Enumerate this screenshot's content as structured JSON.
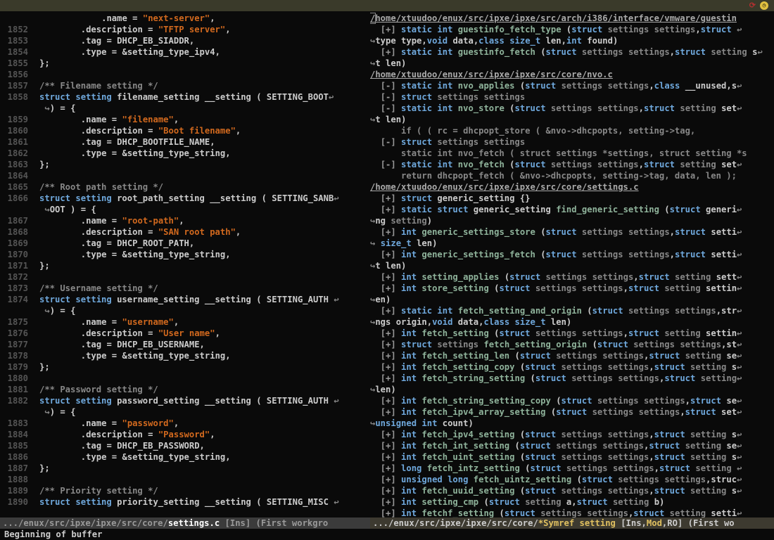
{
  "topbar": {
    "clock_glyph": "◷",
    "sync_glyph": "⟳"
  },
  "left": {
    "lines": [
      {
        "n": "",
        "raw": "            .name = \"next-server\","
      },
      {
        "n": "1852",
        "raw": "        .description = \"TFTP server\","
      },
      {
        "n": "1853",
        "raw": "        .tag = DHCP_EB_SIADDR,"
      },
      {
        "n": "1854",
        "raw": "        .type = &setting_type_ipv4,"
      },
      {
        "n": "1855",
        "raw": "};"
      },
      {
        "n": "1856",
        "raw": ""
      },
      {
        "n": "1857",
        "raw": "/** Filename setting */"
      },
      {
        "n": "1858",
        "raw": "struct setting filename_setting __setting ( SETTING_BOOT",
        "wrap": true
      },
      {
        "n": "",
        "wraplead": true,
        "raw": ") = {"
      },
      {
        "n": "1859",
        "raw": "        .name = \"filename\","
      },
      {
        "n": "1860",
        "raw": "        .description = \"Boot filename\","
      },
      {
        "n": "1861",
        "raw": "        .tag = DHCP_BOOTFILE_NAME,"
      },
      {
        "n": "1862",
        "raw": "        .type = &setting_type_string,"
      },
      {
        "n": "1863",
        "raw": "};"
      },
      {
        "n": "1864",
        "raw": ""
      },
      {
        "n": "1865",
        "raw": "/** Root path setting */"
      },
      {
        "n": "1866",
        "raw": "struct setting root_path_setting __setting ( SETTING_SANB",
        "wrap": true
      },
      {
        "n": "",
        "wraplead": true,
        "raw": "OOT ) = {"
      },
      {
        "n": "1867",
        "raw": "        .name = \"root-path\","
      },
      {
        "n": "1868",
        "raw": "        .description = \"SAN root path\","
      },
      {
        "n": "1869",
        "raw": "        .tag = DHCP_ROOT_PATH,"
      },
      {
        "n": "1870",
        "raw": "        .type = &setting_type_string,"
      },
      {
        "n": "1871",
        "raw": "};"
      },
      {
        "n": "1872",
        "raw": ""
      },
      {
        "n": "1873",
        "raw": "/** Username setting */"
      },
      {
        "n": "1874",
        "raw": "struct setting username_setting __setting ( SETTING_AUTH ",
        "wrap": true
      },
      {
        "n": "",
        "wraplead": true,
        "raw": ") = {"
      },
      {
        "n": "1875",
        "raw": "        .name = \"username\","
      },
      {
        "n": "1876",
        "raw": "        .description = \"User name\","
      },
      {
        "n": "1877",
        "raw": "        .tag = DHCP_EB_USERNAME,"
      },
      {
        "n": "1878",
        "raw": "        .type = &setting_type_string,"
      },
      {
        "n": "1879",
        "raw": "};"
      },
      {
        "n": "1880",
        "raw": ""
      },
      {
        "n": "1881",
        "raw": "/** Password setting */"
      },
      {
        "n": "1882",
        "raw": "struct setting password_setting __setting ( SETTING_AUTH ",
        "wrap": true
      },
      {
        "n": "",
        "wraplead": true,
        "raw": ") = {"
      },
      {
        "n": "1883",
        "raw": "        .name = \"password\","
      },
      {
        "n": "1884",
        "raw": "        .description = \"Password\","
      },
      {
        "n": "1885",
        "raw": "        .tag = DHCP_EB_PASSWORD,"
      },
      {
        "n": "1886",
        "raw": "        .type = &setting_type_string,"
      },
      {
        "n": "1887",
        "raw": "};"
      },
      {
        "n": "1888",
        "raw": ""
      },
      {
        "n": "1889",
        "raw": "/** Priority setting */"
      },
      {
        "n": "1890",
        "raw": "struct setting priority_setting __setting ( SETTING_MISC ",
        "wrap": true,
        "cursor": 8
      }
    ],
    "modeline_prefix": ".../enux/src/ipxe/ipxe/src/core/",
    "modeline_file": "settings.c",
    "modeline_suffix": "   [Ins] (First workgro"
  },
  "right": {
    "lines": [
      {
        "path": "/home/xtuudoo/enux/src/ipxe/ipxe/src/arch/i386/interface/vmware/guestin",
        "cursor": true
      },
      {
        "fold": "[+]",
        "sig": "static int guestinfo_fetch_type (struct settings settings,struct ",
        "wrap": true
      },
      {
        "cont": true,
        "sig2": "type type,void data,class size_t len,int found)"
      },
      {
        "fold": "[+]",
        "sig": "static int guestinfo_fetch (struct settings settings,struct setting s",
        "wrap": true
      },
      {
        "cont": true,
        "sig2": "t len)"
      },
      {
        "path": "/home/xtuudoo/enux/src/ipxe/ipxe/src/core/nvo.c"
      },
      {
        "fold": "[-]",
        "sig": "static int nvo_applies (struct settings settings,class __unused,s",
        "wrap": true
      },
      {
        "fold": "[-]",
        "sig": "struct settings settings"
      },
      {
        "fold": "[-]",
        "sig": "static int nvo_store (struct settings settings,struct setting set",
        "wrap": true
      },
      {
        "cont": true,
        "sig2": "t len)"
      },
      {
        "body": "      if ( ( rc = dhcpopt_store ( &nvo->dhcpopts, setting->tag,"
      },
      {
        "fold": "[-]",
        "sig": "struct settings settings"
      },
      {
        "body": "      static int nvo_fetch ( struct settings *settings, struct setting *s"
      },
      {
        "fold": "[-]",
        "sig": "static int nvo_fetch (struct settings settings,struct setting set",
        "wrap": true
      },
      {
        "body": "      return dhcpopt_fetch ( &nvo->dhcpopts, setting->tag, data, len );"
      },
      {
        "path": "/home/xtuudoo/enux/src/ipxe/ipxe/src/core/settings.c"
      },
      {
        "fold": "[+]",
        "sig": "struct generic_setting {}"
      },
      {
        "fold": "[+]",
        "sig": "static struct generic_setting find_generic_setting (struct generi",
        "wrap": true
      },
      {
        "cont": true,
        "sig2": "ng setting)"
      },
      {
        "fold": "[+]",
        "sig": "int generic_settings_store (struct settings settings,struct setti",
        "wrap": true
      },
      {
        "cont": true,
        "sig2": " size_t len)"
      },
      {
        "fold": "[+]",
        "sig": "int generic_settings_fetch (struct settings settings,struct setti",
        "wrap": true
      },
      {
        "cont": true,
        "sig2": "t len)"
      },
      {
        "fold": "[+]",
        "sig": "int setting_applies (struct settings settings,struct setting sett",
        "wrap": true
      },
      {
        "fold": "[+]",
        "sig": "int store_setting (struct settings settings,struct setting settin",
        "wrap": true
      },
      {
        "cont": true,
        "sig2": "en)"
      },
      {
        "fold": "[+]",
        "sig": "static int fetch_setting_and_origin (struct settings settings,str",
        "wrap": true
      },
      {
        "cont": true,
        "sig2": "ngs origin,void data,class size_t len)"
      },
      {
        "fold": "[+]",
        "sig": "int fetch_setting (struct settings settings,struct setting settin",
        "wrap": true
      },
      {
        "fold": "[+]",
        "sig": "struct settings fetch_setting_origin (struct settings settings,st",
        "wrap": true
      },
      {
        "fold": "[+]",
        "sig": "int fetch_setting_len (struct settings settings,struct setting se",
        "wrap": true
      },
      {
        "fold": "[+]",
        "sig": "int fetch_setting_copy (struct settings settings,struct setting s",
        "wrap": true
      },
      {
        "fold": "[+]",
        "sig": "int fetch_string_setting (struct settings settings,struct setting",
        "wrap": true
      },
      {
        "cont": true,
        "sig2": "len)"
      },
      {
        "fold": "[+]",
        "sig": "int fetch_string_setting_copy (struct settings settings,struct se",
        "wrap": true
      },
      {
        "fold": "[+]",
        "sig": "int fetch_ipv4_array_setting (struct settings settings,struct set",
        "wrap": true
      },
      {
        "cont": true,
        "sig2": "unsigned int count)"
      },
      {
        "fold": "[+]",
        "sig": "int fetch_ipv4_setting (struct settings settings,struct setting s",
        "wrap": true
      },
      {
        "fold": "[+]",
        "sig": "int fetch_int_setting (struct settings settings,struct setting se",
        "wrap": true
      },
      {
        "fold": "[+]",
        "sig": "int fetch_uint_setting (struct settings settings,struct setting s",
        "wrap": true
      },
      {
        "fold": "[+]",
        "sig": "long fetch_intz_setting (struct settings settings,struct setting ",
        "wrap": true
      },
      {
        "fold": "[+]",
        "sig": "unsigned long fetch_uintz_setting (struct settings settings,struc",
        "wrap": true
      },
      {
        "fold": "[+]",
        "sig": "int fetch_uuid_setting (struct settings settings,struct setting s",
        "wrap": true
      },
      {
        "fold": "[+]",
        "sig": "int setting_cmp (struct setting a,struct setting b)"
      },
      {
        "fold": "[+]",
        "sig": "int fetchf_setting (struct settings settings,struct setting setti",
        "wrap": true
      }
    ],
    "modeline_prefix": ".../enux/src/ipxe/ipxe/src/core/",
    "modeline_file": "*Symref setting",
    "modeline_ins": "   [Ins,",
    "modeline_mod": "Mod",
    "modeline_ro": ",RO] (First wo"
  },
  "minibuffer": "Beginning of buffer"
}
